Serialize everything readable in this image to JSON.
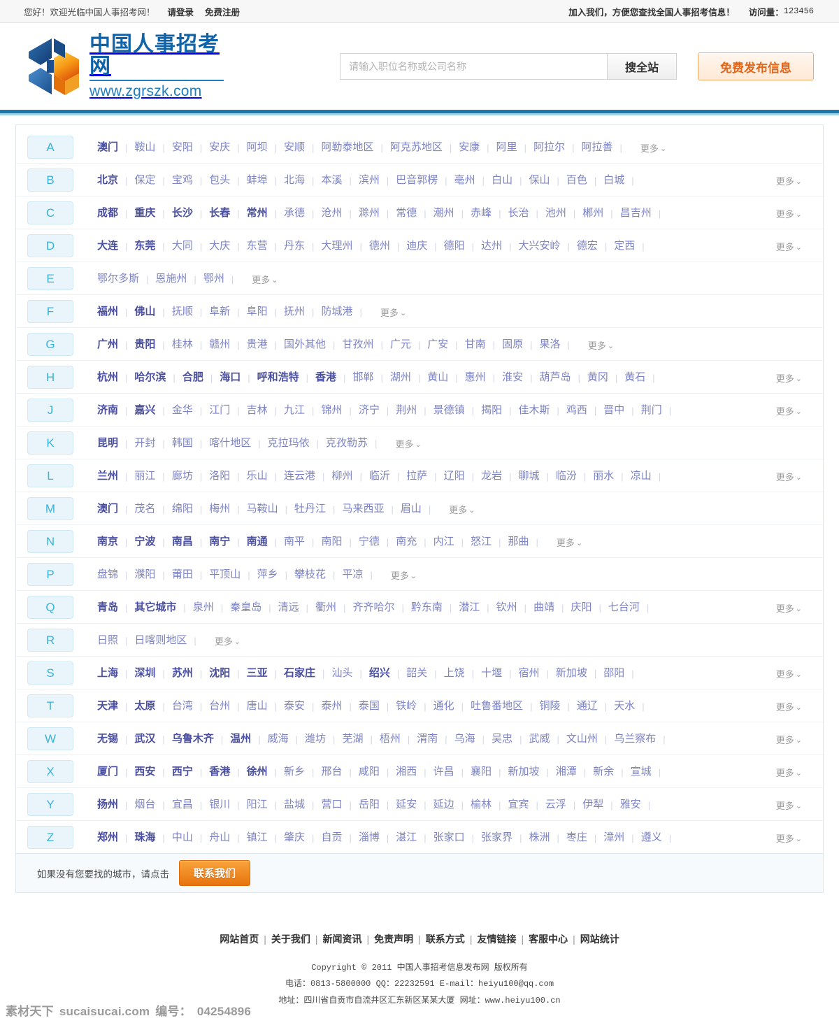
{
  "topbar": {
    "greeting": "您好！欢迎光临中国人事招考网！",
    "login": "请登录",
    "register": "免费注册",
    "join": "加入我们，方便您查找全国人事招考信息！",
    "visits_label": "访问量：",
    "visits_value": "123456"
  },
  "header": {
    "brand_name": "中国人事招考网",
    "brand_url": "www.zgrszk.com",
    "search_placeholder": "请输入职位名称或公司名称",
    "search_value": "",
    "search_button": "搜全站",
    "publish_button": "免费发布信息"
  },
  "city_groups": [
    {
      "letter": "A",
      "cities": [
        "澳门",
        "鞍山",
        "安阳",
        "安庆",
        "阿坝",
        "安顺",
        "阿勒泰地区",
        "阿克苏地区",
        "安康",
        "阿里",
        "阿拉尔",
        "阿拉善"
      ],
      "hot": [
        "澳门"
      ],
      "more": "更多",
      "more_inline": true
    },
    {
      "letter": "B",
      "cities": [
        "北京",
        "保定",
        "宝鸡",
        "包头",
        "蚌埠",
        "北海",
        "本溪",
        "滨州",
        "巴音郭楞",
        "亳州",
        "白山",
        "保山",
        "百色",
        "白城"
      ],
      "hot": [
        "北京"
      ],
      "more": "更多",
      "more_inline": false
    },
    {
      "letter": "C",
      "cities": [
        "成都",
        "重庆",
        "长沙",
        "长春",
        "常州",
        "承德",
        "沧州",
        "滁州",
        "常德",
        "潮州",
        "赤峰",
        "长治",
        "池州",
        "郴州",
        "昌吉州"
      ],
      "hot": [
        "成都",
        "重庆",
        "长沙",
        "长春",
        "常州"
      ],
      "more": "更多",
      "more_inline": false
    },
    {
      "letter": "D",
      "cities": [
        "大连",
        "东莞",
        "大同",
        "大庆",
        "东营",
        "丹东",
        "大理州",
        "德州",
        "迪庆",
        "德阳",
        "达州",
        "大兴安岭",
        "德宏",
        "定西"
      ],
      "hot": [
        "大连",
        "东莞"
      ],
      "more": "更多",
      "more_inline": false
    },
    {
      "letter": "E",
      "cities": [
        "鄂尔多斯",
        "恩施州",
        "鄂州"
      ],
      "hot": [],
      "more": "更多",
      "more_inline": true
    },
    {
      "letter": "F",
      "cities": [
        "福州",
        "佛山",
        "抚顺",
        "阜新",
        "阜阳",
        "抚州",
        "防城港"
      ],
      "hot": [
        "福州",
        "佛山"
      ],
      "more": "更多",
      "more_inline": true
    },
    {
      "letter": "G",
      "cities": [
        "广州",
        "贵阳",
        "桂林",
        "赣州",
        "贵港",
        "国外其他",
        "甘孜州",
        "广元",
        "广安",
        "甘南",
        "固原",
        "果洛"
      ],
      "hot": [
        "广州",
        "贵阳"
      ],
      "more": "更多",
      "more_inline": true
    },
    {
      "letter": "H",
      "cities": [
        "杭州",
        "哈尔滨",
        "合肥",
        "海口",
        "呼和浩特",
        "香港",
        "邯郸",
        "湖州",
        "黄山",
        "惠州",
        "淮安",
        "葫芦岛",
        "黄冈",
        "黄石"
      ],
      "hot": [
        "杭州",
        "哈尔滨",
        "合肥",
        "海口",
        "呼和浩特",
        "香港"
      ],
      "more": "更多",
      "more_inline": false
    },
    {
      "letter": "J",
      "cities": [
        "济南",
        "嘉兴",
        "金华",
        "江门",
        "吉林",
        "九江",
        "锦州",
        "济宁",
        "荆州",
        "景德镇",
        "揭阳",
        "佳木斯",
        "鸡西",
        "晋中",
        "荆门"
      ],
      "hot": [
        "济南",
        "嘉兴"
      ],
      "more": "更多",
      "more_inline": false
    },
    {
      "letter": "K",
      "cities": [
        "昆明",
        "开封",
        "韩国",
        "喀什地区",
        "克拉玛依",
        "克孜勒苏"
      ],
      "hot": [
        "昆明"
      ],
      "more": "更多",
      "more_inline": true
    },
    {
      "letter": "L",
      "cities": [
        "兰州",
        "丽江",
        "廊坊",
        "洛阳",
        "乐山",
        "连云港",
        "柳州",
        "临沂",
        "拉萨",
        "辽阳",
        "龙岩",
        "聊城",
        "临汾",
        "丽水",
        "凉山"
      ],
      "hot": [
        "兰州"
      ],
      "more": "更多",
      "more_inline": false
    },
    {
      "letter": "M",
      "cities": [
        "澳门",
        "茂名",
        "绵阳",
        "梅州",
        "马鞍山",
        "牡丹江",
        "马来西亚",
        "眉山"
      ],
      "hot": [
        "澳门"
      ],
      "more": "更多",
      "more_inline": true
    },
    {
      "letter": "N",
      "cities": [
        "南京",
        "宁波",
        "南昌",
        "南宁",
        "南通",
        "南平",
        "南阳",
        "宁德",
        "南充",
        "内江",
        "怒江",
        "那曲"
      ],
      "hot": [
        "南京",
        "宁波",
        "南昌",
        "南宁",
        "南通"
      ],
      "more": "更多",
      "more_inline": true
    },
    {
      "letter": "P",
      "cities": [
        "盘锦",
        "濮阳",
        "莆田",
        "平顶山",
        "萍乡",
        "攀枝花",
        "平凉"
      ],
      "hot": [],
      "more": "更多",
      "more_inline": true
    },
    {
      "letter": "Q",
      "cities": [
        "青岛",
        "其它城市",
        "泉州",
        "秦皇岛",
        "清远",
        "衢州",
        "齐齐哈尔",
        "黔东南",
        "潜江",
        "钦州",
        "曲靖",
        "庆阳",
        "七台河"
      ],
      "hot": [
        "青岛",
        "其它城市"
      ],
      "more": "更多",
      "more_inline": false
    },
    {
      "letter": "R",
      "cities": [
        "日照",
        "日喀则地区"
      ],
      "hot": [],
      "more": "更多",
      "more_inline": true
    },
    {
      "letter": "S",
      "cities": [
        "上海",
        "深圳",
        "苏州",
        "沈阳",
        "三亚",
        "石家庄",
        "汕头",
        "绍兴",
        "韶关",
        "上饶",
        "十堰",
        "宿州",
        "新加坡",
        "邵阳"
      ],
      "hot": [
        "上海",
        "深圳",
        "苏州",
        "沈阳",
        "三亚",
        "石家庄",
        "绍兴"
      ],
      "more": "更多",
      "more_inline": false
    },
    {
      "letter": "T",
      "cities": [
        "天津",
        "太原",
        "台湾",
        "台州",
        "唐山",
        "泰安",
        "泰州",
        "泰国",
        "铁岭",
        "通化",
        "吐鲁番地区",
        "铜陵",
        "通辽",
        "天水"
      ],
      "hot": [
        "天津",
        "太原"
      ],
      "more": "更多",
      "more_inline": false
    },
    {
      "letter": "W",
      "cities": [
        "无锡",
        "武汉",
        "乌鲁木齐",
        "温州",
        "威海",
        "潍坊",
        "芜湖",
        "梧州",
        "渭南",
        "乌海",
        "吴忠",
        "武威",
        "文山州",
        "乌兰察布"
      ],
      "hot": [
        "无锡",
        "武汉",
        "乌鲁木齐",
        "温州"
      ],
      "more": "更多",
      "more_inline": false
    },
    {
      "letter": "X",
      "cities": [
        "厦门",
        "西安",
        "西宁",
        "香港",
        "徐州",
        "新乡",
        "邢台",
        "咸阳",
        "湘西",
        "许昌",
        "襄阳",
        "新加坡",
        "湘潭",
        "新余",
        "宣城"
      ],
      "hot": [
        "厦门",
        "西安",
        "西宁",
        "香港",
        "徐州"
      ],
      "more": "更多",
      "more_inline": false
    },
    {
      "letter": "Y",
      "cities": [
        "扬州",
        "烟台",
        "宜昌",
        "银川",
        "阳江",
        "盐城",
        "营口",
        "岳阳",
        "延安",
        "延边",
        "榆林",
        "宜宾",
        "云浮",
        "伊犁",
        "雅安"
      ],
      "hot": [
        "扬州"
      ],
      "more": "更多",
      "more_inline": false
    },
    {
      "letter": "Z",
      "cities": [
        "郑州",
        "珠海",
        "中山",
        "舟山",
        "镇江",
        "肇庆",
        "自贡",
        "淄博",
        "湛江",
        "张家口",
        "张家界",
        "株洲",
        "枣庄",
        "漳州",
        "遵义"
      ],
      "hot": [
        "郑州",
        "珠海"
      ],
      "more": "更多",
      "more_inline": false
    }
  ],
  "contact": {
    "text": "如果没有您要找的城市，请点击",
    "button": "联系我们"
  },
  "footer": {
    "nav": [
      "网站首页",
      "关于我们",
      "新闻资讯",
      "免责声明",
      "联系方式",
      "友情链接",
      "客服中心",
      "网站统计"
    ],
    "copyright": "Copyright © 2011   中国人事招考信息发布网 版权所有",
    "contact_line": "电话：0813-5800000   QQ：22232591   E-mail：heiyu100@qq.com",
    "address_line": "地址：四川省自贡市自流井区汇东新区某某大厦 网址：www.heiyu100.cn"
  },
  "watermark": {
    "site_cn": "素材天下",
    "site_latin": "sucaisucai.com",
    "id_label": "编号：",
    "id_value": "04254896"
  }
}
